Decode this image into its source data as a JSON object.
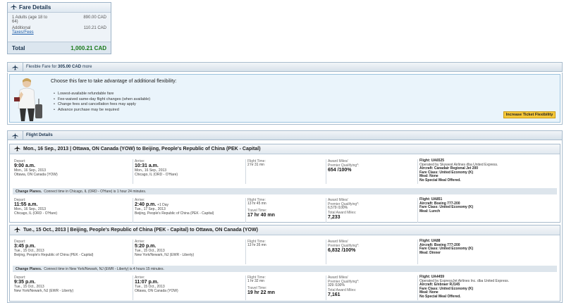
{
  "fare": {
    "title": "Fare Details",
    "adults_label_1": "1 Adults (age 18 to",
    "adults_label_2": "64)",
    "adults_amount": "890.00 CAD",
    "additional_label": "Additional",
    "taxes_link": "Taxes/Fees",
    "additional_amount": "110.21 CAD",
    "total_label": "Total",
    "total_amount": "1,000.21 CAD"
  },
  "flex_bar": {
    "prefix": "Flexible Fare for",
    "amount": "305.00 CAD",
    "more": "more"
  },
  "flex": {
    "title": "Choose this fare to take advantage of additional flexibility:",
    "bullets": [
      "Lowest-available refundable fare",
      "Fee-waived same-day flight changes (when available)",
      "Change fees and cancellation fees may apply",
      "Advance purchase may be required"
    ],
    "button": "Increase Ticket Flexibility"
  },
  "details_bar": {
    "title": "Flight Details"
  },
  "legs": [
    {
      "header": "Mon., 16 Sep., 2013 | Ottawa, ON Canada (YOW) to Beijing, People's Republic of China (PEK - Capital)",
      "segments": [
        {
          "depart_label": "Depart:",
          "depart_time": "9:00 a.m.",
          "depart_date": "Mon., 16 Sep., 2013",
          "depart_place": "Ottawa, ON Canada (YOW)",
          "arrive_label": "Arrive:",
          "arrive_time": "10:31 a.m.",
          "arrive_date": "Mon., 16 Sep., 2013",
          "arrive_place": "Chicago, IL (ORD - O'Hare)",
          "ft_label": "Flight Time:",
          "ft_value": "2 hr 31 mn",
          "tt_label": "",
          "tt_value": "",
          "miles_label": "Award Miles/",
          "pq_label": "Premier Qualifying*:",
          "miles_value": "654 /100%",
          "total_miles_label": "",
          "total_miles_value": "",
          "flight": "Flight: UA6525",
          "operated": "Operated by Skywest Airlines dba United Express.",
          "aircraft": "Aircraft: Canadair Regional Jet 200",
          "fare_class": "Fare Class: United Economy (K)",
          "meal": "Meal: None",
          "special": "No Special Meal Offered."
        },
        {
          "depart_label": "Depart:",
          "depart_time": "11:55 a.m.",
          "depart_date": "Mon., 16 Sep., 2013",
          "depart_place": "Chicago, IL (ORD - O'Hare)",
          "arrive_label": "Arrive:",
          "arrive_time": "2:40 p.m.",
          "arrive_plus": "+1 Day",
          "arrive_date": "Tue., 17 Sep., 2013",
          "arrive_place": "Beijing, People's Republic of China (PEK - Capital)",
          "ft_label": "Flight Time:",
          "ft_value": "13 hr 45 mn",
          "tt_label": "Travel Time:",
          "tt_value": "17 hr 40 mn",
          "miles_label": "Award Miles/",
          "pq_label": "Premier Qualifying*:",
          "miles_value": "6,579 /100%",
          "total_miles_label": "Total Award Miles:",
          "total_miles_value": "7,233",
          "flight": "Flight: UA851",
          "operated": "",
          "aircraft": "Aircraft: Boeing 777-200",
          "fare_class": "Fare Class: United Economy (K)",
          "meal": "Meal: Lunch",
          "special": ""
        }
      ],
      "change": {
        "bold": "Change Planes.",
        "text": "Connect time in Chicago, IL (ORD - O'Hare) is 1 hour 24 minutes."
      }
    },
    {
      "header": "Tue., 15 Oct., 2013 | Beijing, People's Republic of China (PEK - Capital) to Ottawa, ON Canada (YOW)",
      "segments": [
        {
          "depart_label": "Depart:",
          "depart_time": "3:45 p.m.",
          "depart_date": "Tue., 15 Oct., 2013",
          "depart_place": "Beijing, People's Republic of China (PEK - Capital)",
          "arrive_label": "Arrive:",
          "arrive_time": "5:20 p.m.",
          "arrive_date": "Tue., 15 Oct., 2013",
          "arrive_place": "New York/Newark, NJ (EWR - Liberty)",
          "ft_label": "Flight Time:",
          "ft_value": "13 hr 35 mn",
          "tt_label": "",
          "tt_value": "",
          "miles_label": "Award Miles/",
          "pq_label": "Premier Qualifying*:",
          "miles_value": "6,832 /100%",
          "total_miles_label": "",
          "total_miles_value": "",
          "flight": "Flight: UA88",
          "operated": "",
          "aircraft": "Aircraft: Boeing 777-200",
          "fare_class": "Fare Class: United Economy (K)",
          "meal": "Meal: Dinner",
          "special": ""
        },
        {
          "depart_label": "Depart:",
          "depart_time": "9:35 p.m.",
          "depart_date": "Tue., 15 Oct., 2013",
          "depart_place": "New York/Newark, NJ (EWR - Liberty)",
          "arrive_label": "Arrive:",
          "arrive_time": "11:07 p.m.",
          "arrive_date": "Tue., 15 Oct., 2013",
          "arrive_place": "Ottawa, ON Canada (YOW)",
          "ft_label": "Flight Time:",
          "ft_value": "1 hr 32 mn",
          "tt_label": "Travel Time:",
          "tt_value": "19 hr 22 mn",
          "miles_label": "Award Miles/",
          "pq_label": "Premier Qualifying*:",
          "miles_value": "329 /100%",
          "total_miles_label": "Total Award Miles:",
          "total_miles_value": "7,161",
          "flight": "Flight: UA4459",
          "operated": "Operated by ExpressJet Airlines Inc. dba United Express.",
          "aircraft": "Aircraft: Embraer RJ145",
          "fare_class": "Fare Class: United Economy (K)",
          "meal": "Meal: None",
          "special": "No Special Meal Offered."
        }
      ],
      "change": {
        "bold": "Change Planes.",
        "text": "Connect time in New York/Newark, NJ (EWR - Liberty) is 4 hours 15 minutes."
      }
    }
  ]
}
